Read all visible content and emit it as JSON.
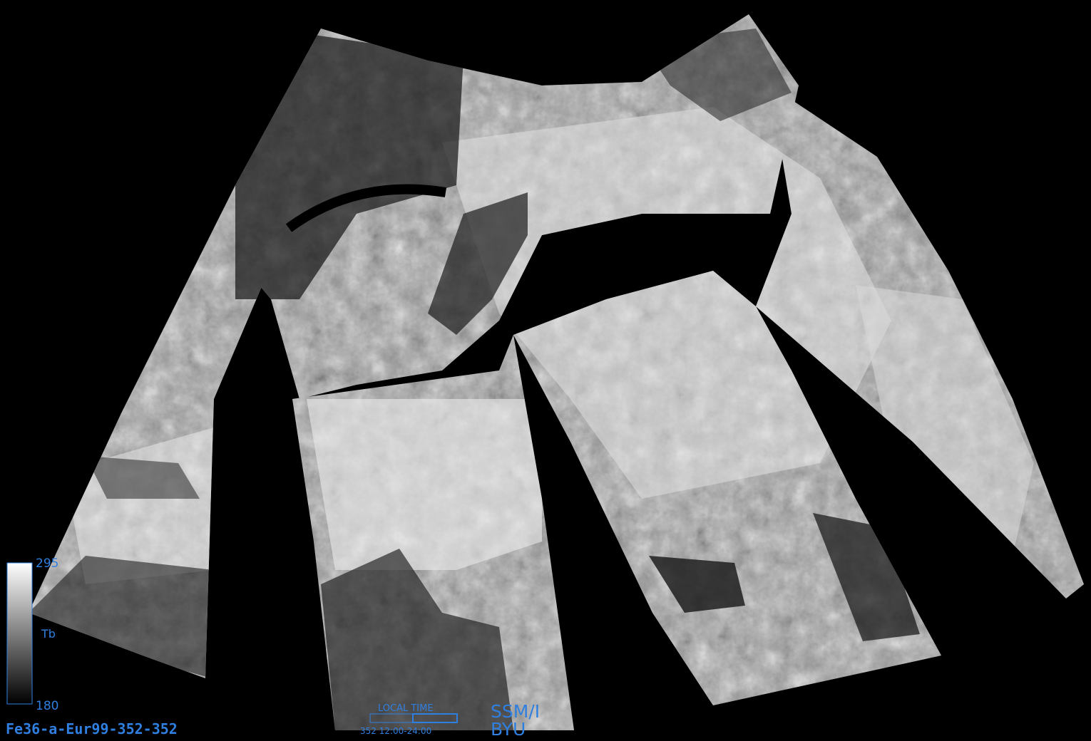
{
  "image": {
    "product_id": "Fe36-a-Eur99-352-352",
    "sensor_label": "SSM/I",
    "org_label": "BYU"
  },
  "colorbar": {
    "max_label": "295",
    "min_label": "180",
    "variable_label": "Tb",
    "gradient_top": "#ffffff",
    "gradient_bottom": "#000000"
  },
  "local_time": {
    "title": "LOCAL TIME",
    "range_label": "352  12:00-24:00"
  },
  "colors": {
    "annotation_blue": "#2f7fe0",
    "background": "#000000"
  }
}
